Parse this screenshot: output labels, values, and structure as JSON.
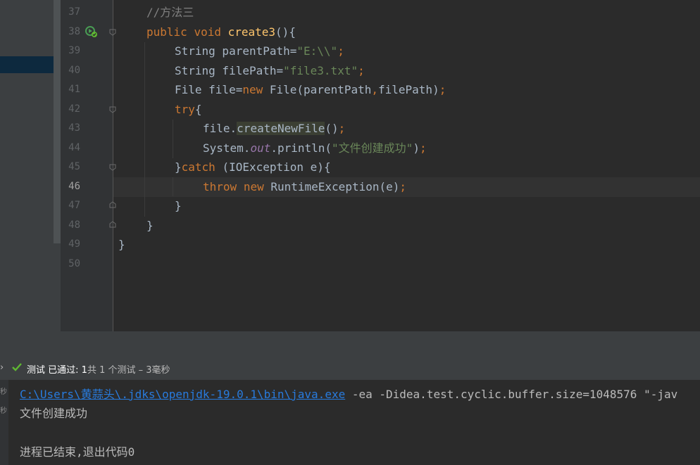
{
  "editor": {
    "lines": [
      {
        "n": "37"
      },
      {
        "n": "38"
      },
      {
        "n": "39"
      },
      {
        "n": "40"
      },
      {
        "n": "41"
      },
      {
        "n": "42"
      },
      {
        "n": "43"
      },
      {
        "n": "44"
      },
      {
        "n": "45"
      },
      {
        "n": "46"
      },
      {
        "n": "47"
      },
      {
        "n": "48"
      },
      {
        "n": "49"
      },
      {
        "n": "50"
      }
    ],
    "tokens": {
      "l37_comment": "//方法三",
      "l38_public": "public",
      "l38_void": "void",
      "l38_name": "create3",
      "l38_rest": "(){",
      "l39_a": "String parentPath=",
      "l39_str": "\"E:\\\\\"",
      "l39_end": ";",
      "l40_a": "String filePath=",
      "l40_str": "\"file3.txt\"",
      "l40_end": ";",
      "l41_a": "File file=",
      "l41_new": "new",
      "l41_b": " File(parentPath",
      "l41_comma": ",",
      "l41_c": "filePath)",
      "l41_end": ";",
      "l42_try": "try",
      "l42_brace": "{",
      "l43_a": "file.",
      "l43_method": "createNewFile",
      "l43_b": "()",
      "l43_end": ";",
      "l44_a": "System.",
      "l44_out": "out",
      "l44_b": ".println(",
      "l44_str": "\"文件创建成功\"",
      "l44_c": ")",
      "l44_end": ";",
      "l45_a": "}",
      "l45_catch": "catch",
      "l45_b": " (IOException e){",
      "l46_throw": "throw",
      "l46_new": "new",
      "l46_b": " RuntimeException(e)",
      "l46_end": ";",
      "l47": "}",
      "l48": "}",
      "l49": "}"
    }
  },
  "run_panel": {
    "status_label": "测试 已通过:",
    "passed_count": "1",
    "summary": "共 1 个测试 – 3毫秒"
  },
  "console": {
    "exe_path": "C:\\Users\\黄蒜头\\.jdks\\openjdk-19.0.1\\bin\\java.exe",
    "args": " -ea -Didea.test.cyclic.buffer.size=1048576 \"-jav",
    "output_line": "文件创建成功",
    "exit_line": "进程已结束,退出代码0"
  },
  "colors": {
    "editor_bg": "#2b2b2b",
    "keyword": "#cc7832",
    "string": "#6a8759",
    "function": "#ffc66d",
    "pass_green": "#5fb832",
    "link": "#287bde"
  },
  "icons": {
    "run_gutter": "run-test-icon",
    "pass": "checkmark-icon"
  }
}
